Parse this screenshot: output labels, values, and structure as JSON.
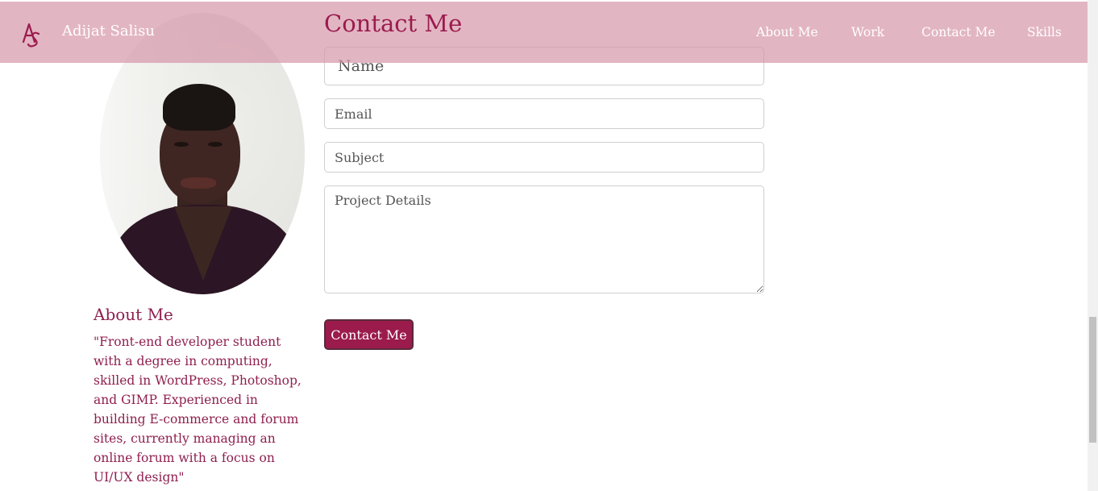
{
  "header": {
    "logo_text": "AS",
    "brand": "Adijat Salisu",
    "nav": [
      "About Me",
      "Work",
      "Contact Me",
      "Skills"
    ]
  },
  "profile": {
    "about_heading": "About Me",
    "about_text": "\"Front-end developer student with a degree in computing, skilled in WordPress, Photoshop, and GIMP. Experienced in building E-commerce and forum sites, currently managing an online forum with a focus on UI/UX design\""
  },
  "contact": {
    "heading": "Contact Me",
    "name_placeholder": "Name",
    "email_placeholder": "Email",
    "subject_placeholder": "Subject",
    "details_placeholder": "Project Details",
    "submit_label": "Contact Me"
  },
  "colors": {
    "accent": "#9b1b4c",
    "navbar": "#d696aa"
  }
}
